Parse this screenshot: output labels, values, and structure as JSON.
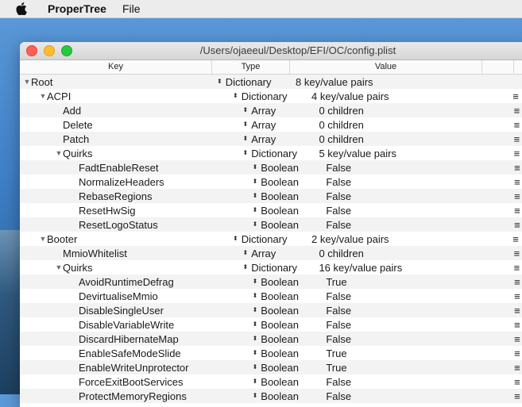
{
  "menubar": {
    "app_name": "ProperTree",
    "menus": [
      "File"
    ]
  },
  "window": {
    "title": "/Users/ojaeeul/Desktop/EFI/OC/config.plist"
  },
  "columns": {
    "key": "Key",
    "type": "Type",
    "value": "Value"
  },
  "rows": [
    {
      "key": "Root",
      "type": "Dictionary",
      "value": "8 key/value pairs",
      "expanded": true,
      "menu": false
    },
    {
      "key": "ACPI",
      "type": "Dictionary",
      "value": "4 key/value pairs",
      "expanded": true,
      "menu": true
    },
    {
      "key": "Add",
      "type": "Array",
      "value": "0 children",
      "menu": true
    },
    {
      "key": "Delete",
      "type": "Array",
      "value": "0 children",
      "menu": true
    },
    {
      "key": "Patch",
      "type": "Array",
      "value": "0 children",
      "menu": true
    },
    {
      "key": "Quirks",
      "type": "Dictionary",
      "value": "5 key/value pairs",
      "expanded": true,
      "menu": true
    },
    {
      "key": "FadtEnableReset",
      "type": "Boolean",
      "value": "False",
      "menu": true
    },
    {
      "key": "NormalizeHeaders",
      "type": "Boolean",
      "value": "False",
      "menu": true
    },
    {
      "key": "RebaseRegions",
      "type": "Boolean",
      "value": "False",
      "menu": true
    },
    {
      "key": "ResetHwSig",
      "type": "Boolean",
      "value": "False",
      "menu": true
    },
    {
      "key": "ResetLogoStatus",
      "type": "Boolean",
      "value": "False",
      "menu": true
    },
    {
      "key": "Booter",
      "type": "Dictionary",
      "value": "2 key/value pairs",
      "expanded": true,
      "menu": true
    },
    {
      "key": "MmioWhitelist",
      "type": "Array",
      "value": "0 children",
      "menu": true
    },
    {
      "key": "Quirks",
      "type": "Dictionary",
      "value": "16 key/value pairs",
      "expanded": true,
      "menu": true
    },
    {
      "key": "AvoidRuntimeDefrag",
      "type": "Boolean",
      "value": "True",
      "menu": true
    },
    {
      "key": "DevirtualiseMmio",
      "type": "Boolean",
      "value": "False",
      "menu": true
    },
    {
      "key": "DisableSingleUser",
      "type": "Boolean",
      "value": "False",
      "menu": true
    },
    {
      "key": "DisableVariableWrite",
      "type": "Boolean",
      "value": "False",
      "menu": true
    },
    {
      "key": "DiscardHibernateMap",
      "type": "Boolean",
      "value": "False",
      "menu": true
    },
    {
      "key": "EnableSafeModeSlide",
      "type": "Boolean",
      "value": "True",
      "menu": true
    },
    {
      "key": "EnableWriteUnprotector",
      "type": "Boolean",
      "value": "True",
      "menu": true
    },
    {
      "key": "ForceExitBootServices",
      "type": "Boolean",
      "value": "False",
      "menu": true
    },
    {
      "key": "ProtectMemoryRegions",
      "type": "Boolean",
      "value": "False",
      "menu": true
    }
  ],
  "glyphs": {
    "expanded": "▼",
    "updown": "⬍",
    "row_menu": "≡"
  }
}
